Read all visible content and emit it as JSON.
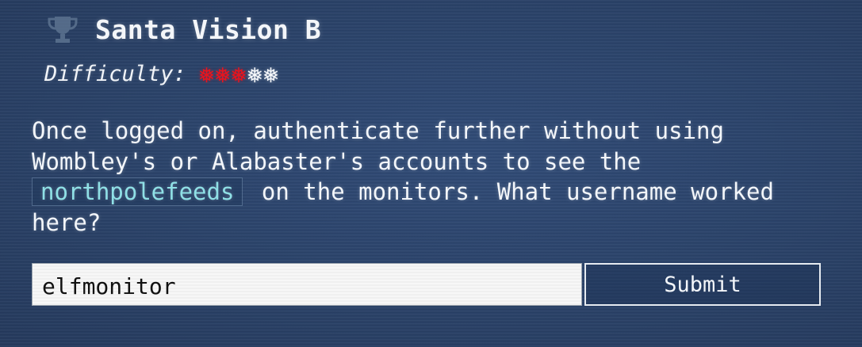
{
  "objective": {
    "title": "Santa Vision B",
    "trophy_icon": "trophy-icon",
    "difficulty": {
      "label": "Difficulty:",
      "level": 3,
      "max": 5,
      "active_color": "#e8141e",
      "inactive_color": "#f6f8fb"
    },
    "description": {
      "before": "Once logged on, authenticate further without using Wombley's or Alabaster's accounts to see the",
      "code": "northpolefeeds",
      "after": "on the monitors. What username worked here?"
    }
  },
  "answer": {
    "value": "elfmonitor",
    "submit_label": "Submit"
  }
}
